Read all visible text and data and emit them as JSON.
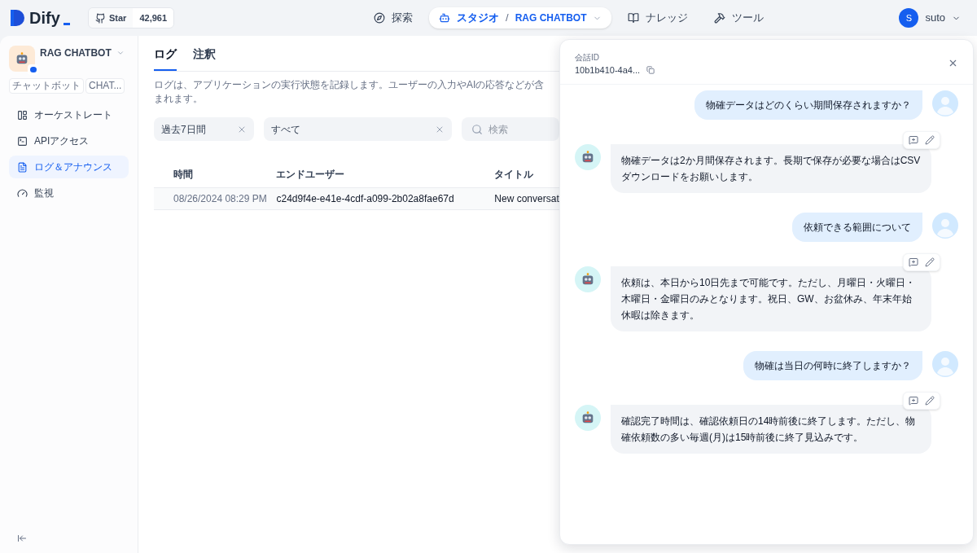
{
  "header": {
    "logo": "Dify",
    "github": {
      "label": "Star",
      "count": "42,961"
    },
    "nav": [
      {
        "label": "探索",
        "selected": false
      },
      {
        "label": "スタジオ",
        "selected": true,
        "separator": "/",
        "sub": "RAG CHATBOT"
      },
      {
        "label": "ナレッジ",
        "selected": false
      },
      {
        "label": "ツール",
        "selected": false
      }
    ],
    "user": {
      "initial": "S",
      "name": "suto"
    }
  },
  "app": {
    "name": "RAG CHATBOT",
    "tags": [
      "チャットボット",
      "CHAT..."
    ]
  },
  "sidebar": {
    "items": [
      {
        "label": "オーケストレート",
        "selected": false
      },
      {
        "label": "APIアクセス",
        "selected": false
      },
      {
        "label": "ログ＆アナウンス",
        "selected": true
      },
      {
        "label": "監視",
        "selected": false
      }
    ]
  },
  "tabs": [
    {
      "label": "ログ",
      "selected": true
    },
    {
      "label": "注釈",
      "selected": false
    }
  ],
  "description": "ログは、アプリケーションの実行状態を記録します。ユーザーの入力やAIの応答などが含まれます。",
  "filters": {
    "period": "過去7日間",
    "status": "すべて",
    "search_placeholder": "検索"
  },
  "table": {
    "columns": [
      "時間",
      "エンドユーザー",
      "タイトル"
    ],
    "rows": [
      [
        "08/26/2024 08:29 PM",
        "c24d9f4e-e41e-4cdf-a099-2b02a8fae67d",
        "New conversat"
      ]
    ]
  },
  "drawer": {
    "label": "会話ID",
    "conversation_id": "10b1b410-4a4...",
    "messages": [
      {
        "kind": "user",
        "text": "物確データはどのくらい期間保存されますか？"
      },
      {
        "kind": "bot",
        "text": "物確データは2か月間保存されます。長期で保存が必要な場合はCSVダウンロードをお願いします。"
      },
      {
        "kind": "user",
        "text": "依頼できる範囲について"
      },
      {
        "kind": "bot",
        "text": "依頼は、本日から10日先まで可能です。ただし、月曜日・火曜日・木曜日・金曜日のみとなります。祝日、GW、お盆休み、年末年始休暇は除きます。"
      },
      {
        "kind": "user",
        "text": "物確は当日の何時に終了しますか？"
      },
      {
        "kind": "bot",
        "text": "確認完了時間は、確認依頼日の14時前後に終了します。ただし、物確依頼数の多い毎週(月)は15時前後に終了見込みです。"
      }
    ]
  }
}
